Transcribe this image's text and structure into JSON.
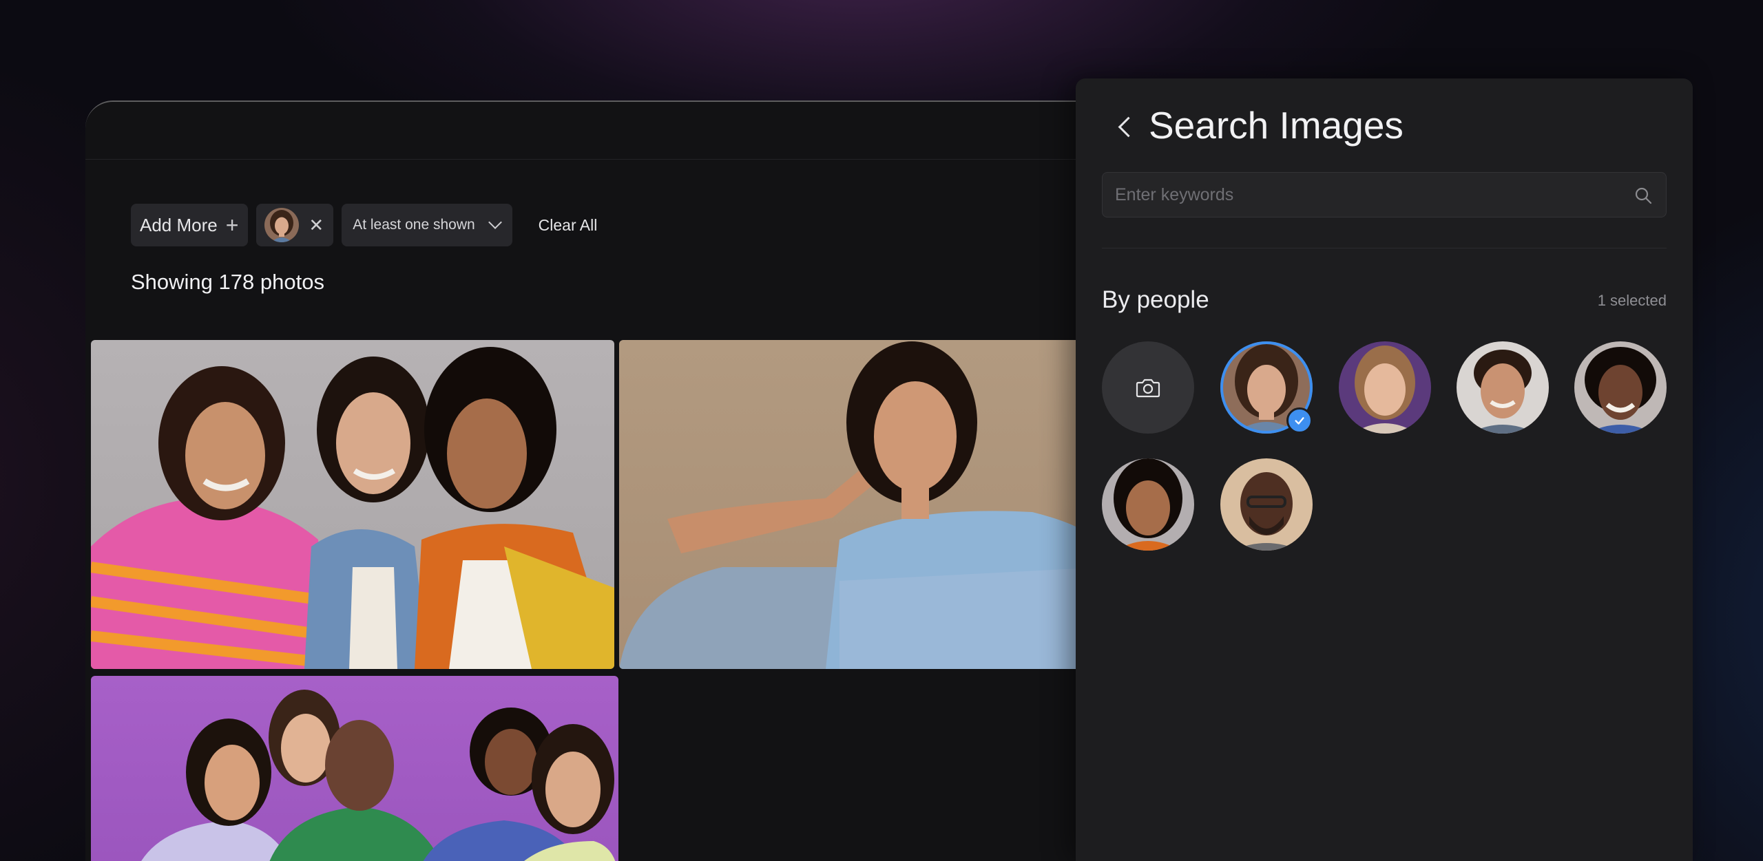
{
  "filters": {
    "add_more_label": "Add More",
    "add_icon": "plus-icon",
    "remove_icon": "close-icon",
    "match_mode": "At least one shown",
    "clear_all_label": "Clear All"
  },
  "results": {
    "showing_label": "Showing 178 photos"
  },
  "panel": {
    "title": "Search Images",
    "back_icon": "chevron-left-icon",
    "search_placeholder": "Enter keywords",
    "search_value": "",
    "search_icon": "search-icon",
    "section_title": "By people",
    "selected_count": "1 selected",
    "camera_icon": "camera-icon",
    "accent_color": "#3d8ff0"
  },
  "people": [
    {
      "name": "person-1",
      "selected": true
    },
    {
      "name": "person-2",
      "selected": false
    },
    {
      "name": "person-3",
      "selected": false
    },
    {
      "name": "person-4",
      "selected": false
    },
    {
      "name": "person-5",
      "selected": false
    },
    {
      "name": "person-6",
      "selected": false
    }
  ]
}
